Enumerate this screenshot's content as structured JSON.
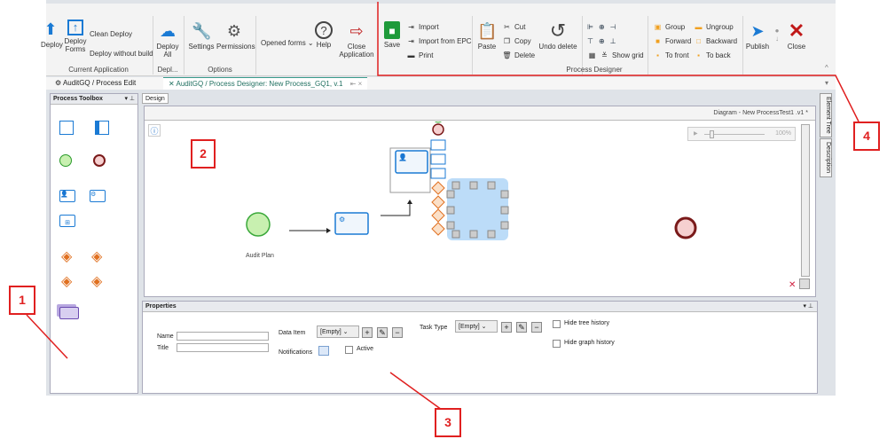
{
  "ribbon": {
    "current_application": {
      "deploy": "Deploy",
      "deploy_forms": "Deploy Forms",
      "clean_deploy": "Clean Deploy",
      "deploy_without_build": "Deploy without build",
      "group": "Current Application"
    },
    "deploy": {
      "deploy_all": "Deploy All",
      "group": "Depl..."
    },
    "options": {
      "settings": "Settings",
      "permissions": "Permissions",
      "group": "Options"
    },
    "opened_forms": "Opened forms",
    "help": "Help",
    "close_application": "Close Application",
    "process_designer": {
      "save": "Save",
      "import": "Import",
      "import_epc": "Import from EPC",
      "print": "Print",
      "paste": "Paste",
      "cut": "Cut",
      "copy": "Copy",
      "delete": "Delete",
      "undo_delete": "Undo delete",
      "show_grid": "Show grid",
      "group_btn": "Group",
      "ungroup": "Ungroup",
      "forward": "Forward",
      "backward": "Backward",
      "to_front": "To front",
      "to_back": "To back",
      "publish": "Publish",
      "close": "Close",
      "group": "Process Designer"
    }
  },
  "tabs": [
    {
      "label": "AuditGQ / Process Edit"
    },
    {
      "label": "AuditGQ / Process Designer: New Process_GQ1, v.1"
    }
  ],
  "toolbox": {
    "title": "Process Toolbox"
  },
  "design": {
    "tab": "Design",
    "diagram_title": "Diagram - New ProcessTest1 .v1 *",
    "zoom": "100%",
    "start_label": "Audit Plan"
  },
  "side_tabs": [
    "Element Tree",
    "Description"
  ],
  "properties": {
    "title": "Properties",
    "name_label": "Name",
    "name_value": "",
    "title_label": "Title",
    "title_value": "",
    "data_item_label": "Data Item",
    "data_item_value": "[Empty]",
    "notifications_label": "Notifications",
    "active_label": "Active",
    "task_type_label": "Task Type",
    "task_type_value": "[Empty]",
    "hide_tree_history": "Hide tree history",
    "hide_graph_history": "Hide graph history"
  },
  "annotations": [
    "1",
    "2",
    "3",
    "4"
  ],
  "colors": {
    "annotation": "#e02020",
    "accent_blue": "#1a7ad4",
    "start_event": "#c8f0b0",
    "end_event": "#7a1a1a"
  }
}
